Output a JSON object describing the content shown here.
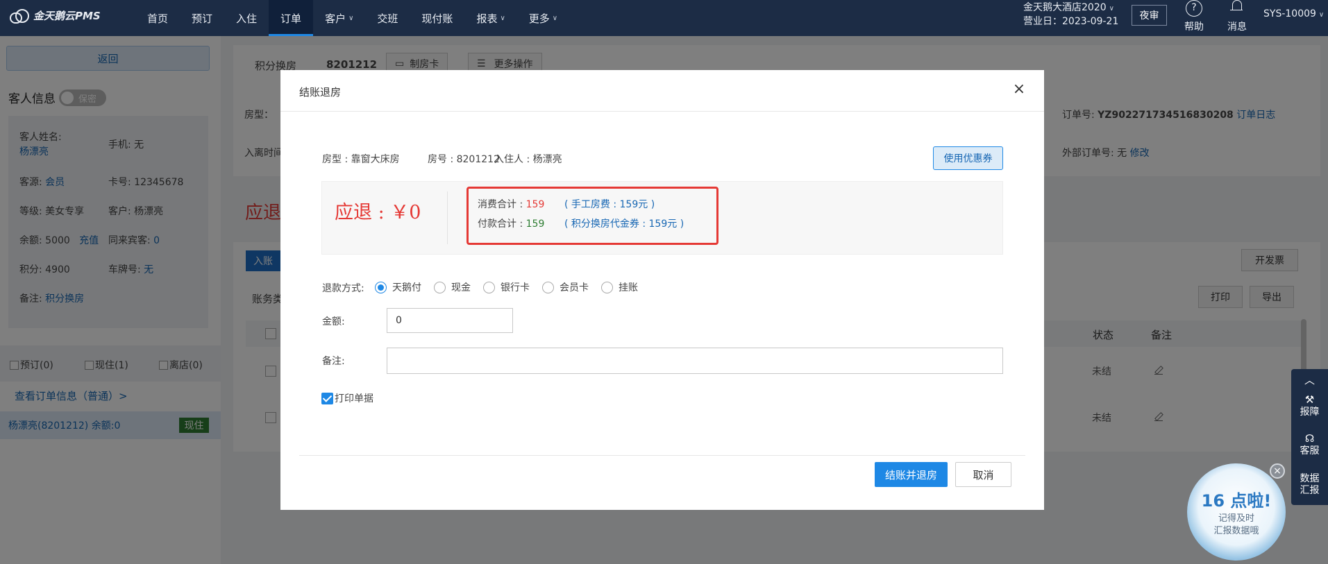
{
  "nav": {
    "brand": "金天鹅云PMS",
    "items": [
      {
        "label": "首页",
        "dropdown": false,
        "active": false
      },
      {
        "label": "预订",
        "dropdown": false,
        "active": false
      },
      {
        "label": "入住",
        "dropdown": false,
        "active": false
      },
      {
        "label": "订单",
        "dropdown": false,
        "active": true
      },
      {
        "label": "客户",
        "dropdown": true,
        "active": false
      },
      {
        "label": "交班",
        "dropdown": false,
        "active": false
      },
      {
        "label": "现付账",
        "dropdown": false,
        "active": false
      },
      {
        "label": "报表",
        "dropdown": true,
        "active": false
      },
      {
        "label": "更多",
        "dropdown": true,
        "active": false
      }
    ],
    "hotel_name": "金天鹅大酒店2020",
    "business_date": "营业日：2023-09-21",
    "night_audit": "夜审",
    "help": "帮助",
    "messages": "消息",
    "user": "SYS-10009"
  },
  "sidebar": {
    "back": "返回",
    "guest_info_title": "客人信息",
    "privacy": "保密",
    "guest_name_label": "客人姓名:",
    "guest_name": "杨漂亮",
    "phone": "手机: 无",
    "source_label": "客源:",
    "source": "会员",
    "card_no": "卡号: 12345678",
    "level": "等级: 美女专享",
    "customer": "客户: 杨漂亮",
    "balance": "余额: 5000",
    "recharge": "充值",
    "companions_label": "同来宾客:",
    "companions": "0",
    "points": "积分: 4900",
    "plate_label": "车牌号:",
    "plate": "无",
    "remark_label": "备注:",
    "remark": "积分换房",
    "status_filters": [
      "预订(0)",
      "现住(1)",
      "离店(0)"
    ],
    "order_info_link": "查看订单信息（普通）>",
    "guest_row": "杨漂亮(8201212)   余额:0",
    "guest_row_status": "现住"
  },
  "main": {
    "order_type": "积分换房",
    "room_no": "8201212",
    "make_card": "制房卡",
    "more_ops": "更多操作",
    "room_type_peek": "房型：",
    "stay_time_peek": "入离时间",
    "order_no_label": "订单号:",
    "order_no": "YZ902271734516830208",
    "order_log": "订单日志",
    "ext_order_label": "外部订单号:",
    "ext_order_value": "无",
    "ext_order_edit": "修改",
    "refund_peek": "应退",
    "enter_account": "入账",
    "invoice": "开发票",
    "account_type_peek": "账务类",
    "print": "打印",
    "export": "导出",
    "table_headers": {
      "status": "状态",
      "remark": "备注"
    },
    "rows": [
      {
        "status": "未结"
      },
      {
        "status": "未结"
      }
    ]
  },
  "right_tools": {
    "report": "报障",
    "service": "客服",
    "data_report": "数据汇报"
  },
  "promo": {
    "title": "16 点啦!",
    "line1": "记得及时",
    "line2": "汇报数据哦"
  },
  "modal": {
    "title": "结账退房",
    "room_type": "房型 : 靠窗大床房",
    "room_no": "房号 : 8201212",
    "occupant": "入住人 : 杨漂亮",
    "coupon_button": "使用优惠券",
    "refund": "应退 : ￥0",
    "consume_label": "消费合计 : ",
    "consume_value": "159",
    "consume_detail": "( 手工房费 : 159元 )",
    "payment_label": "付款合计 : ",
    "payment_value": "159",
    "payment_detail": "( 积分换房代金券 : 159元 )",
    "refund_method_label": "退款方式:",
    "refund_methods": [
      {
        "label": "天鹅付",
        "checked": true
      },
      {
        "label": "现金",
        "checked": false
      },
      {
        "label": "银行卡",
        "checked": false
      },
      {
        "label": "会员卡",
        "checked": false
      },
      {
        "label": "挂账",
        "checked": false
      }
    ],
    "amount_label": "金额:",
    "amount_value": "0",
    "remark_label": "备注:",
    "remark_value": "",
    "print_receipt": "打印单据",
    "confirm": "结账并退房",
    "cancel": "取消"
  }
}
